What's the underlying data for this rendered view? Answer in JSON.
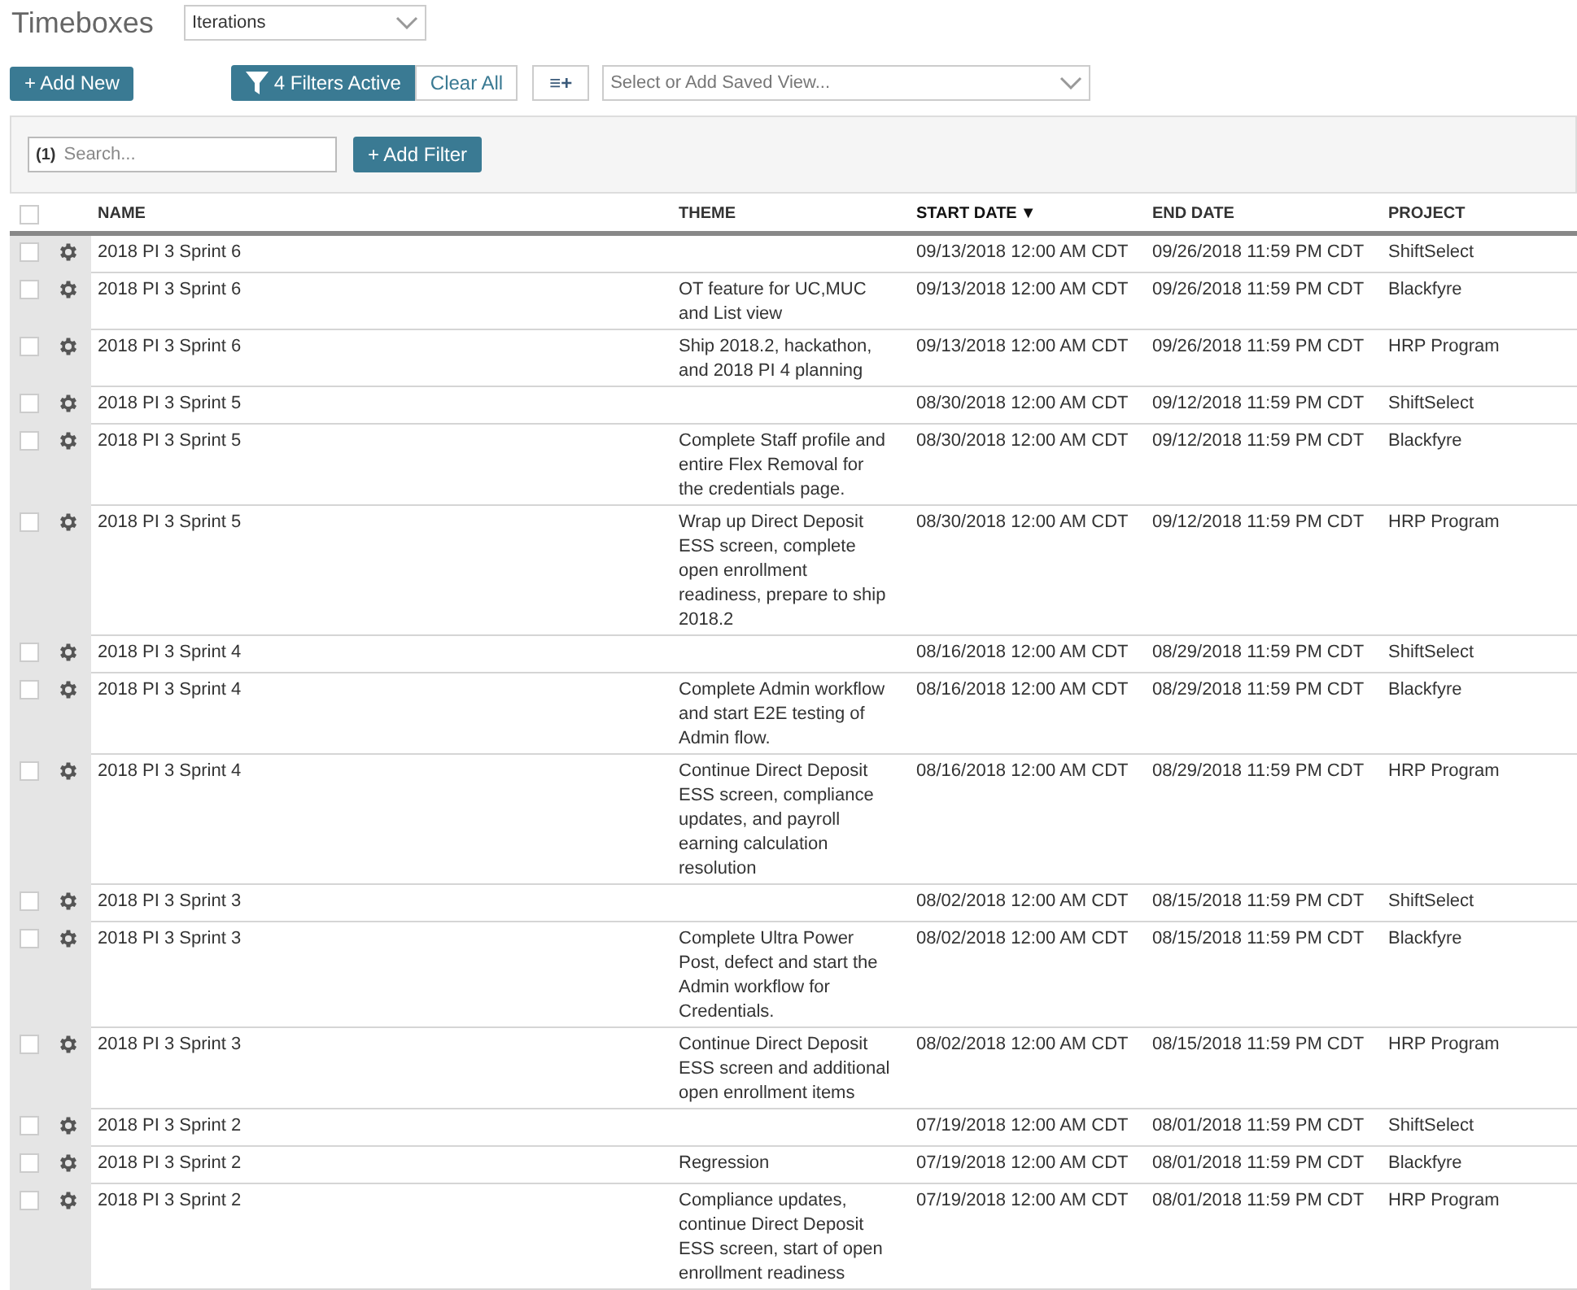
{
  "title": "Timeboxes",
  "type_select": {
    "value": "Iterations"
  },
  "toolbar": {
    "add_new": "+ Add New",
    "filters_active": "4 Filters Active",
    "clear_all": "Clear All",
    "columns_button": "≡+",
    "saved_view": {
      "placeholder": "Select or Add Saved View..."
    }
  },
  "filter_panel": {
    "search": {
      "count": "(1)",
      "placeholder": "Search..."
    },
    "add_filter": "+ Add Filter"
  },
  "table": {
    "select_all": {
      "checked": false
    },
    "columns": [
      {
        "label": "NAME",
        "sorted": false
      },
      {
        "label": "THEME",
        "sorted": false
      },
      {
        "label": "START DATE",
        "sorted": true,
        "sort_indicator": "▼"
      },
      {
        "label": "END DATE",
        "sorted": false
      },
      {
        "label": "PROJECT",
        "sorted": false
      }
    ],
    "rows": [
      {
        "checked": false,
        "name": "2018 PI 3 Sprint 6",
        "theme": "",
        "start": "09/13/2018 12:00 AM CDT",
        "end": "09/26/2018 11:59 PM CDT",
        "project": "ShiftSelect"
      },
      {
        "checked": false,
        "name": "2018 PI 3 Sprint 6",
        "theme": "OT feature for UC,MUC\nand List view",
        "start": "09/13/2018 12:00 AM CDT",
        "end": "09/26/2018 11:59 PM CDT",
        "project": "Blackfyre"
      },
      {
        "checked": false,
        "name": "2018 PI 3 Sprint 6",
        "theme": "Ship 2018.2, hackathon,\nand 2018 PI 4 planning",
        "start": "09/13/2018 12:00 AM CDT",
        "end": "09/26/2018 11:59 PM CDT",
        "project": "HRP Program"
      },
      {
        "checked": false,
        "name": "2018 PI 3 Sprint 5",
        "theme": "",
        "start": "08/30/2018 12:00 AM CDT",
        "end": "09/12/2018 11:59 PM CDT",
        "project": "ShiftSelect"
      },
      {
        "checked": false,
        "name": "2018 PI 3 Sprint 5",
        "theme": "Complete Staff profile and\nentire Flex Removal for\nthe credentials page.",
        "start": "08/30/2018 12:00 AM CDT",
        "end": "09/12/2018 11:59 PM CDT",
        "project": "Blackfyre"
      },
      {
        "checked": false,
        "name": "2018 PI 3 Sprint 5",
        "theme": "Wrap up Direct Deposit\nESS screen, complete\nopen enrollment\nreadiness, prepare to ship\n2018.2",
        "start": "08/30/2018 12:00 AM CDT",
        "end": "09/12/2018 11:59 PM CDT",
        "project": "HRP Program"
      },
      {
        "checked": false,
        "name": "2018 PI 3 Sprint 4",
        "theme": "",
        "start": "08/16/2018 12:00 AM CDT",
        "end": "08/29/2018 11:59 PM CDT",
        "project": "ShiftSelect"
      },
      {
        "checked": false,
        "name": "2018 PI 3 Sprint 4",
        "theme": "Complete Admin workflow\nand start E2E testing of\nAdmin flow.",
        "start": "08/16/2018 12:00 AM CDT",
        "end": "08/29/2018 11:59 PM CDT",
        "project": "Blackfyre"
      },
      {
        "checked": false,
        "name": "2018 PI 3 Sprint 4",
        "theme": "Continue Direct Deposit\nESS screen, compliance\nupdates, and payroll\nearning calculation\nresolution",
        "start": "08/16/2018 12:00 AM CDT",
        "end": "08/29/2018 11:59 PM CDT",
        "project": "HRP Program"
      },
      {
        "checked": false,
        "name": "2018 PI 3 Sprint 3",
        "theme": "",
        "start": "08/02/2018 12:00 AM CDT",
        "end": "08/15/2018 11:59 PM CDT",
        "project": "ShiftSelect"
      },
      {
        "checked": false,
        "name": "2018 PI 3 Sprint 3",
        "theme": "Complete Ultra Power\nPost, defect and start the\nAdmin workflow for\nCredentials.",
        "start": "08/02/2018 12:00 AM CDT",
        "end": "08/15/2018 11:59 PM CDT",
        "project": "Blackfyre"
      },
      {
        "checked": false,
        "name": "2018 PI 3 Sprint 3",
        "theme": "Continue Direct Deposit\nESS screen and additional\nopen enrollment items",
        "start": "08/02/2018 12:00 AM CDT",
        "end": "08/15/2018 11:59 PM CDT",
        "project": "HRP Program"
      },
      {
        "checked": false,
        "name": "2018 PI 3 Sprint 2",
        "theme": "",
        "start": "07/19/2018 12:00 AM CDT",
        "end": "08/01/2018 11:59 PM CDT",
        "project": "ShiftSelect"
      },
      {
        "checked": false,
        "name": "2018 PI 3 Sprint 2",
        "theme": "Regression",
        "start": "07/19/2018 12:00 AM CDT",
        "end": "08/01/2018 11:59 PM CDT",
        "project": "Blackfyre"
      },
      {
        "checked": false,
        "name": "2018 PI 3 Sprint 2",
        "theme": "Compliance updates,\ncontinue Direct Deposit\nESS screen, start of open\nenrollment readiness",
        "start": "07/19/2018 12:00 AM CDT",
        "end": "08/01/2018 11:59 PM CDT",
        "project": "HRP Program"
      }
    ]
  }
}
